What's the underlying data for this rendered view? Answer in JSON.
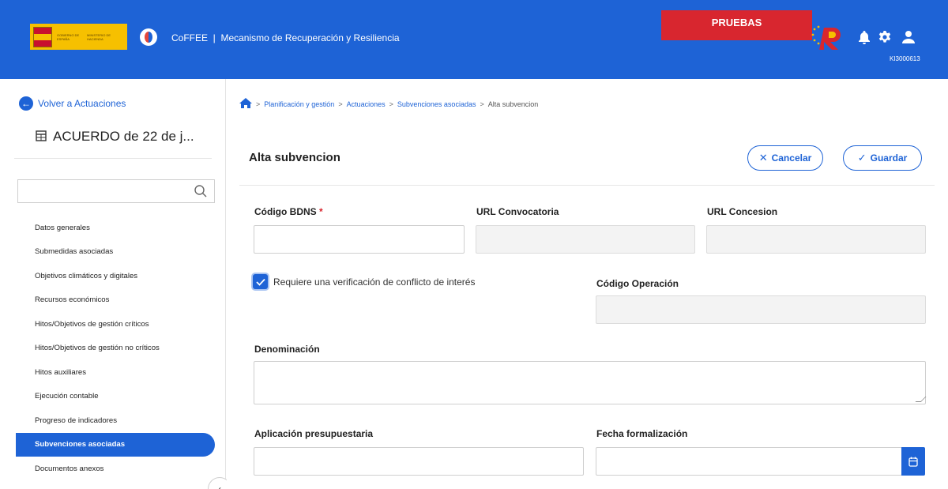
{
  "header": {
    "gov_logo_text_1": "GOBIERNO DE ESPAÑA",
    "gov_logo_text_2": "MINISTERIO DE HACIENDA",
    "app_title": "CoFFEE  |  Mecanismo de Recuperación y Resiliencia",
    "environment_badge": "PRUEBAS",
    "user_code": "KI3000613",
    "icons": [
      "prtr-logo-icon",
      "bell-icon",
      "gear-icon",
      "user-icon"
    ]
  },
  "sidebar": {
    "back_label": "Volver a Actuaciones",
    "record_title": "ACUERDO de 22 de j...",
    "search_placeholder": "",
    "items": [
      {
        "label": "Datos generales",
        "active": false
      },
      {
        "label": "Submedidas asociadas",
        "active": false
      },
      {
        "label": "Objetivos climáticos y digitales",
        "active": false
      },
      {
        "label": "Recursos económicos",
        "active": false
      },
      {
        "label": "Hitos/Objetivos de gestión críticos",
        "active": false
      },
      {
        "label": "Hitos/Objetivos de gestión no críticos",
        "active": false
      },
      {
        "label": "Hitos auxiliares",
        "active": false
      },
      {
        "label": "Ejecución contable",
        "active": false
      },
      {
        "label": "Progreso de indicadores",
        "active": false
      },
      {
        "label": "Subvenciones asociadas",
        "active": true
      },
      {
        "label": "Documentos anexos",
        "active": false
      }
    ],
    "collapse_glyph": "‹"
  },
  "breadcrumb": {
    "items": [
      "Planificación y gestión",
      "Actuaciones",
      "Subvenciones asociadas"
    ],
    "current": "Alta subvencion",
    "separator": ">"
  },
  "page": {
    "title": "Alta subvencion",
    "cancel_label": "Cancelar",
    "save_label": "Guardar"
  },
  "form": {
    "codigo_bdns": {
      "label": "Código BDNS",
      "required_mark": "*",
      "value": ""
    },
    "url_convocatoria": {
      "label": "URL Convocatoria",
      "value": ""
    },
    "url_concesion": {
      "label": "URL Concesion",
      "value": ""
    },
    "conflicto_interes": {
      "label": "Requiere una verificación de conflicto de interés",
      "checked": true
    },
    "codigo_operacion": {
      "label": "Código Operación",
      "value": ""
    },
    "denominacion": {
      "label": "Denominación",
      "value": ""
    },
    "aplicacion_presupuestaria": {
      "label": "Aplicación presupuestaria",
      "value": ""
    },
    "fecha_formalizacion": {
      "label": "Fecha formalización",
      "value": ""
    }
  },
  "colors": {
    "primary": "#1e63d6",
    "badge": "#d8262f",
    "gov_yellow": "#f6c000"
  }
}
